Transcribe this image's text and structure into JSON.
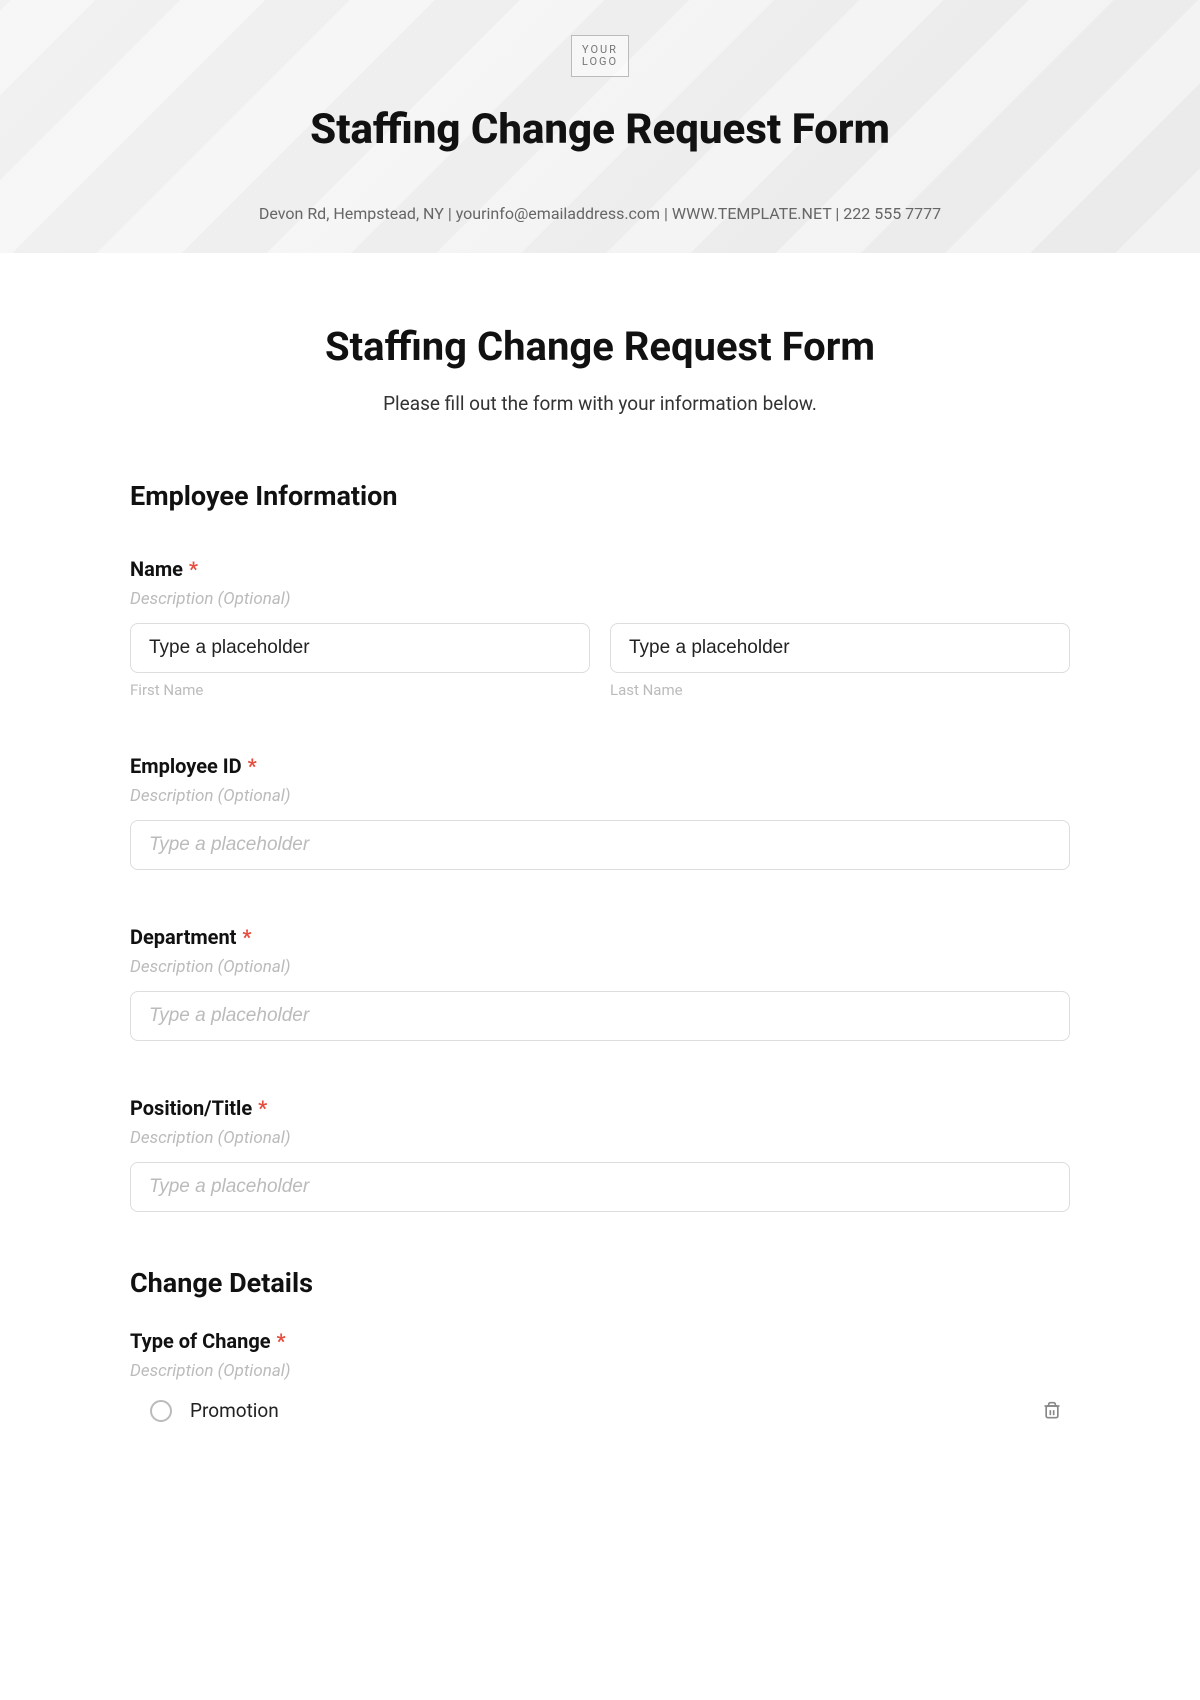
{
  "header": {
    "logo_line1": "YOUR",
    "logo_line2": "LOGO",
    "title": "Staffing Change Request Form",
    "contact": "Devon Rd, Hempstead, NY | yourinfo@emailaddress.com | WWW.TEMPLATE.NET | 222 555 7777"
  },
  "form": {
    "title": "Staffing Change Request Form",
    "subtitle": "Please fill out the form with your information below."
  },
  "sections": {
    "employee_info": "Employee Information",
    "change_details": "Change Details"
  },
  "fields": {
    "name": {
      "label": "Name",
      "description": "Description (Optional)",
      "first_placeholder": "Type a placeholder",
      "last_placeholder": "Type a placeholder",
      "first_sub": "First Name",
      "last_sub": "Last Name"
    },
    "employee_id": {
      "label": "Employee ID",
      "description": "Description (Optional)",
      "placeholder": "Type a placeholder"
    },
    "department": {
      "label": "Department",
      "description": "Description (Optional)",
      "placeholder": "Type a placeholder"
    },
    "position": {
      "label": "Position/Title",
      "description": "Description (Optional)",
      "placeholder": "Type a placeholder"
    },
    "type_of_change": {
      "label": "Type of Change",
      "description": "Description (Optional)",
      "option1": "Promotion"
    }
  },
  "required_mark": "*"
}
